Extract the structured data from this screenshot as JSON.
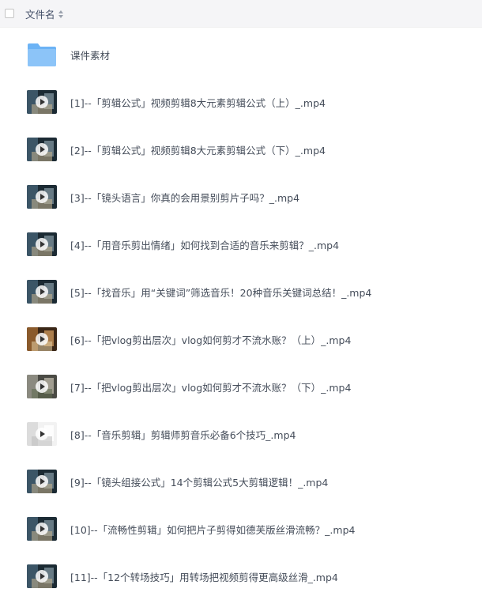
{
  "header": {
    "column_label": "文件名"
  },
  "files": [
    {
      "name": "课件素材",
      "type": "folder"
    },
    {
      "name": "[1]--「剪辑公式」视频剪辑8大元素剪辑公式（上）_.mp4",
      "type": "video",
      "thumb": "dark"
    },
    {
      "name": "[2]--「剪辑公式」视频剪辑8大元素剪辑公式（下）_.mp4",
      "type": "video",
      "thumb": "dark"
    },
    {
      "name": "[3]--「镜头语言」你真的会用景别剪片子吗？_.mp4",
      "type": "video",
      "thumb": "dark"
    },
    {
      "name": "[4]--「用音乐剪出情绪」如何找到合适的音乐来剪辑？_.mp4",
      "type": "video",
      "thumb": "dark"
    },
    {
      "name": "[5]--「找音乐」用“关键词”筛选音乐！20种音乐关键词总结！_.mp4",
      "type": "video",
      "thumb": "dark"
    },
    {
      "name": "[6]--「把vlog剪出层次」vlog如何剪才不流水账？（上）_.mp4",
      "type": "video",
      "thumb": "warm"
    },
    {
      "name": "[7]--「把vlog剪出层次」vlog如何剪才不流水账？（下）_.mp4",
      "type": "video",
      "thumb": "street"
    },
    {
      "name": "[8]--「音乐剪辑」剪辑师剪音乐必备6个技巧_.mp4",
      "type": "video",
      "thumb": "light"
    },
    {
      "name": "[9]--「镜头组接公式」14个剪辑公式5大剪辑逻辑！_.mp4",
      "type": "video",
      "thumb": "dark"
    },
    {
      "name": "[10]--「流畅性剪辑」如何把片子剪得如德芙版丝滑流畅？_.mp4",
      "type": "video",
      "thumb": "dark"
    },
    {
      "name": "[11]--「12个转场技巧」用转场把视频剪得更高级丝滑_.mp4",
      "type": "video",
      "thumb": "dark"
    }
  ],
  "colors": {
    "folder": "#6cb3f5",
    "header_bg": "#f5f5f7",
    "text": "#454d5a"
  }
}
